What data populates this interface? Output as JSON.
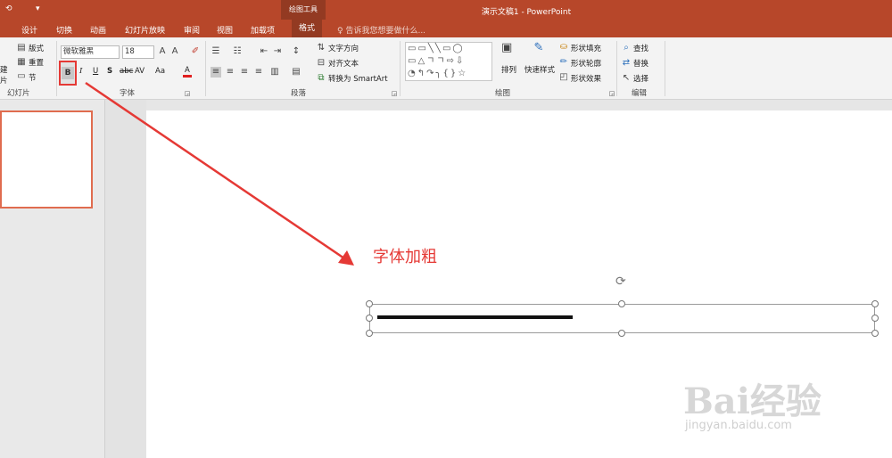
{
  "window": {
    "title": "演示文稿1 - PowerPoint",
    "context_tab_group": "绘图工具"
  },
  "tabs": [
    "设计",
    "切换",
    "动画",
    "幻灯片放映",
    "审阅",
    "视图",
    "加载项",
    "格式"
  ],
  "active_tab": "格式",
  "tell_me": "告诉我您想要做什么...",
  "ribbon": {
    "slides_group": {
      "label": "幻灯片",
      "layout": "版式",
      "reset": "重置",
      "section": "节",
      "new_partial": "建",
      "new_partial2": "片"
    },
    "font_group": {
      "label": "字体",
      "font_name": "微软雅黑",
      "font_size": "18",
      "bold": "B",
      "italic": "I",
      "underline": "U",
      "shadow": "S",
      "strike": "abc",
      "spacing": "AV",
      "case": "Aa",
      "color": "A"
    },
    "paragraph_group": {
      "label": "段落",
      "text_direction": "文字方向",
      "align_text": "对齐文本",
      "smartart": "转换为 SmartArt"
    },
    "drawing_group": {
      "label": "绘图",
      "arrange": "排列",
      "quick_styles": "快速样式",
      "shape_fill": "形状填充",
      "shape_outline": "形状轮廓",
      "shape_effects": "形状效果"
    },
    "editing_group": {
      "label": "编辑",
      "find": "查找",
      "replace": "替换",
      "select": "选择"
    }
  },
  "slide": {
    "annotation": "字体加粗"
  },
  "watermark": {
    "text": "Bai经验",
    "url": "jingyan.baidu.com"
  }
}
